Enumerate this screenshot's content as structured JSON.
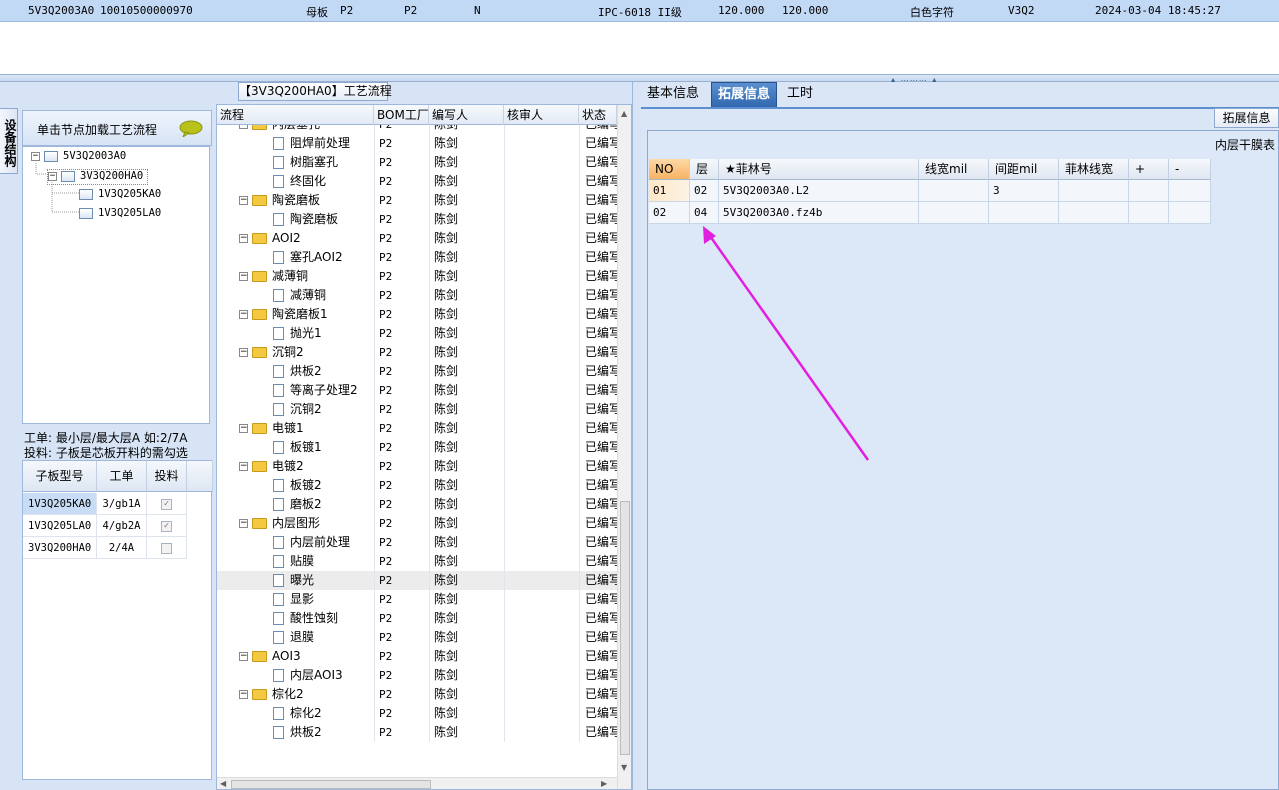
{
  "top_row": {
    "cells": [
      "5V3Q2003A0",
      "10010500000970",
      "母板",
      "P2",
      "P2",
      "N",
      "IPC-6018 II级",
      "120.000",
      "120.000",
      "白色字符",
      "V3Q2",
      "2024-03-04 18:45:27"
    ]
  },
  "left": {
    "vertical_tab": "设备结构",
    "click_header": "单击节点加载工艺流程",
    "bom_tree": [
      {
        "label": "5V3Q2003A0"
      },
      {
        "label": "3V3Q200HA0"
      },
      {
        "label": "1V3Q205KA0"
      },
      {
        "label": "1V3Q205LA0"
      }
    ],
    "note_line1": "工单: 最小层/最大层A 如:2/7A",
    "note_line2": "投料: 子板是芯板开料的需勾选",
    "sub_grid": {
      "headers": [
        "子板型号",
        "工单",
        "投料"
      ],
      "rows": [
        {
          "model": "1V3Q205KA0",
          "order": "3/gb1A",
          "checked": true
        },
        {
          "model": "1V3Q205LA0",
          "order": "4/gb2A",
          "checked": true
        },
        {
          "model": "3V3Q200HA0",
          "order": "2/4A",
          "checked": false
        }
      ]
    }
  },
  "middle": {
    "title": "【3V3Q200HA0】工艺流程",
    "headers": [
      "流程",
      "BOM工厂",
      "编写人",
      "核审人",
      "状态"
    ],
    "rows": [
      {
        "name": "内层塞孔",
        "type": "folder",
        "plant": "P2",
        "author": "陈剑",
        "status": "已编写"
      },
      {
        "name": "阻焊前处理",
        "type": "doc",
        "plant": "P2",
        "author": "陈剑",
        "status": "已编写"
      },
      {
        "name": "树脂塞孔",
        "type": "doc",
        "plant": "P2",
        "author": "陈剑",
        "status": "已编写"
      },
      {
        "name": "终固化",
        "type": "doc",
        "plant": "P2",
        "author": "陈剑",
        "status": "已编写"
      },
      {
        "name": "陶瓷磨板",
        "type": "folder",
        "plant": "P2",
        "author": "陈剑",
        "status": "已编写"
      },
      {
        "name": "陶瓷磨板",
        "type": "doc",
        "plant": "P2",
        "author": "陈剑",
        "status": "已编写"
      },
      {
        "name": "AOI2",
        "type": "folder",
        "plant": "P2",
        "author": "陈剑",
        "status": "已编写"
      },
      {
        "name": "塞孔AOI2",
        "type": "doc",
        "plant": "P2",
        "author": "陈剑",
        "status": "已编写"
      },
      {
        "name": "减薄铜",
        "type": "folder",
        "plant": "P2",
        "author": "陈剑",
        "status": "已编写"
      },
      {
        "name": "减薄铜",
        "type": "doc",
        "plant": "P2",
        "author": "陈剑",
        "status": "已编写"
      },
      {
        "name": "陶瓷磨板1",
        "type": "folder",
        "plant": "P2",
        "author": "陈剑",
        "status": "已编写"
      },
      {
        "name": "抛光1",
        "type": "doc",
        "plant": "P2",
        "author": "陈剑",
        "status": "已编写"
      },
      {
        "name": "沉铜2",
        "type": "folder",
        "plant": "P2",
        "author": "陈剑",
        "status": "已编写"
      },
      {
        "name": "烘板2",
        "type": "doc",
        "plant": "P2",
        "author": "陈剑",
        "status": "已编写"
      },
      {
        "name": "等离子处理2",
        "type": "doc",
        "plant": "P2",
        "author": "陈剑",
        "status": "已编写"
      },
      {
        "name": "沉铜2",
        "type": "doc",
        "plant": "P2",
        "author": "陈剑",
        "status": "已编写"
      },
      {
        "name": "电镀1",
        "type": "folder",
        "plant": "P2",
        "author": "陈剑",
        "status": "已编写"
      },
      {
        "name": "板镀1",
        "type": "doc",
        "plant": "P2",
        "author": "陈剑",
        "status": "已编写"
      },
      {
        "name": "电镀2",
        "type": "folder",
        "plant": "P2",
        "author": "陈剑",
        "status": "已编写"
      },
      {
        "name": "板镀2",
        "type": "doc",
        "plant": "P2",
        "author": "陈剑",
        "status": "已编写"
      },
      {
        "name": "磨板2",
        "type": "doc",
        "plant": "P2",
        "author": "陈剑",
        "status": "已编写"
      },
      {
        "name": "内层图形",
        "type": "folder",
        "plant": "P2",
        "author": "陈剑",
        "status": "已编写"
      },
      {
        "name": "内层前处理",
        "type": "doc",
        "plant": "P2",
        "author": "陈剑",
        "status": "已编写"
      },
      {
        "name": "贴膜",
        "type": "doc",
        "plant": "P2",
        "author": "陈剑",
        "status": "已编写"
      },
      {
        "name": "曝光",
        "type": "doc",
        "plant": "P2",
        "author": "陈剑",
        "status": "已编写",
        "selected": true
      },
      {
        "name": "显影",
        "type": "doc",
        "plant": "P2",
        "author": "陈剑",
        "status": "已编写"
      },
      {
        "name": "酸性蚀刻",
        "type": "doc",
        "plant": "P2",
        "author": "陈剑",
        "status": "已编写"
      },
      {
        "name": "退膜",
        "type": "doc",
        "plant": "P2",
        "author": "陈剑",
        "status": "已编写"
      },
      {
        "name": "AOI3",
        "type": "folder",
        "plant": "P2",
        "author": "陈剑",
        "status": "已编写"
      },
      {
        "name": "内层AOI3",
        "type": "doc",
        "plant": "P2",
        "author": "陈剑",
        "status": "已编写"
      },
      {
        "name": "棕化2",
        "type": "folder",
        "plant": "P2",
        "author": "陈剑",
        "status": "已编写"
      },
      {
        "name": "棕化2",
        "type": "doc",
        "plant": "P2",
        "author": "陈剑",
        "status": "已编写"
      },
      {
        "name": "烘板2",
        "type": "doc",
        "plant": "P2",
        "author": "陈剑",
        "status": "已编写"
      }
    ]
  },
  "right": {
    "tabs": [
      "基本信息",
      "拓展信息",
      "工时"
    ],
    "active_tab": "拓展信息",
    "ext_button": "拓展信息",
    "inner_title": "内层干膜表",
    "grid": {
      "headers": [
        "NO",
        "层",
        "★菲林号",
        "线宽mil",
        "间距mil",
        "菲林线宽",
        "+",
        "-"
      ],
      "rows": [
        {
          "no": "01",
          "layer": "02",
          "film": "5V3Q2003A0.L2",
          "width": "",
          "spacing": "3",
          "film_width": ""
        },
        {
          "no": "02",
          "layer": "04",
          "film": "5V3Q2003A0.fz4b",
          "width": "",
          "spacing": "",
          "film_width": ""
        }
      ]
    }
  },
  "colors": {
    "annotation_arrow": "#e020e0",
    "active_tab": "#2f66ad",
    "folder": "#f5c842"
  }
}
